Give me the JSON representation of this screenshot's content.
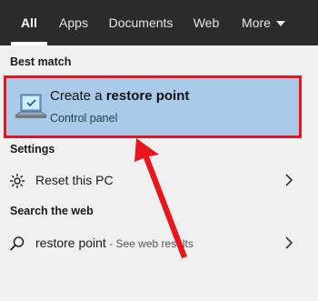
{
  "tabs": [
    {
      "label": "All"
    },
    {
      "label": "Apps"
    },
    {
      "label": "Documents"
    },
    {
      "label": "Web"
    },
    {
      "label": "More"
    }
  ],
  "best_match": {
    "heading": "Best match",
    "title_prefix": "Create a ",
    "title_bold": "restore point",
    "subtitle": "Control panel"
  },
  "settings": {
    "heading": "Settings",
    "item_label": "Reset this PC"
  },
  "web": {
    "heading": "Search the web",
    "query": "restore point",
    "hint": " - See web results"
  },
  "colors": {
    "topbar": "#2b2b2b",
    "highlight": "#a9cbe9",
    "annotation_red": "#e8151c"
  }
}
